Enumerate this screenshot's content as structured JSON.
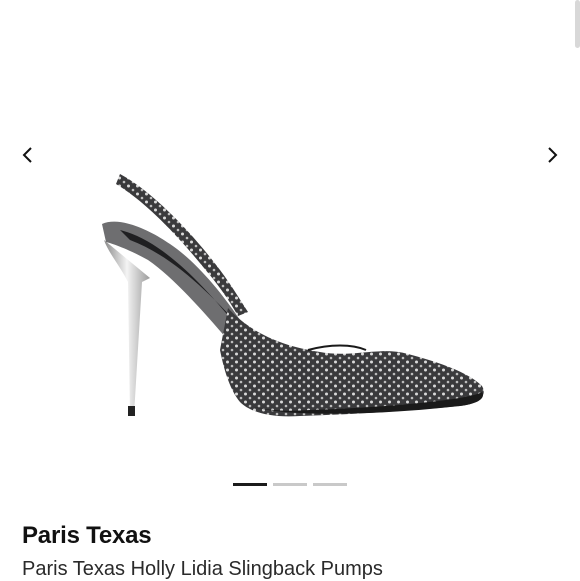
{
  "gallery": {
    "image_label": "Paris Texas Holly Lidia Slingback Pumps",
    "prev_icon": "chevron-left-icon",
    "next_icon": "chevron-right-icon",
    "slide_count": 3,
    "active_slide": 1
  },
  "product": {
    "brand": "Paris Texas",
    "name": "Paris Texas Holly Lidia Slingback Pumps"
  }
}
